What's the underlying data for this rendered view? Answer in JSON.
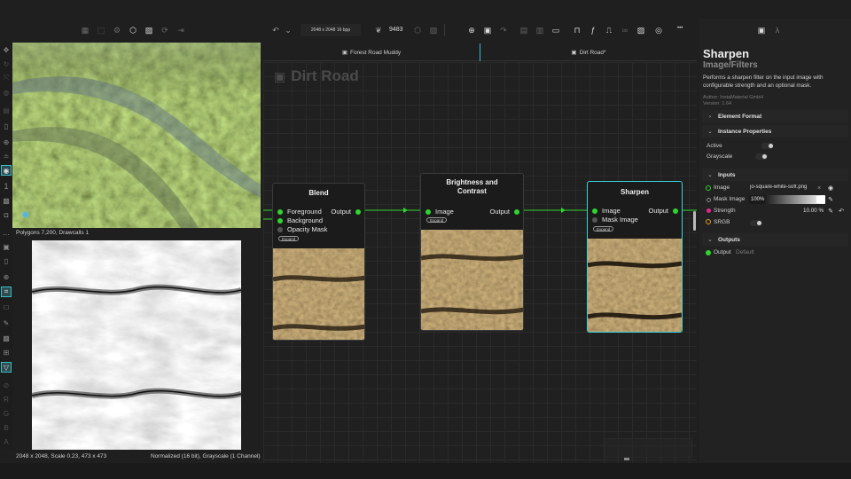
{
  "viewport_toolbar": {
    "icons": [
      "film-icon",
      "cube-open-icon",
      "gear-icon",
      "cube-icon",
      "image-icon",
      "refresh-icon",
      "export-icon"
    ]
  },
  "left_toolbar": {
    "group1": [
      "move-icon",
      "rotate-icon",
      "scale-icon",
      "sphere-icon",
      "layers-icon",
      "clipboard-icon",
      "target-icon",
      "lines-icon",
      "eye-icon"
    ],
    "channel_number": "1",
    "group2": [
      "checker-icon",
      "camera-icon",
      "more-icon",
      "save-icon",
      "clipboard-icon",
      "target-icon",
      "select-icon",
      "square-icon",
      "pen-icon",
      "checker-icon",
      "grid-icon",
      "triangle-icon",
      "lock-icon"
    ],
    "channels": [
      "R",
      "G",
      "B",
      "A"
    ]
  },
  "viewport_3d": {
    "status": "Polygons 7,200, Drawcalls 1"
  },
  "viewport_2d": {
    "status_left": "2048 x 2048, Scale 0.23, 473 x 473",
    "status_right": "Normalized (16 bit), Grayscale (1 Channel)"
  },
  "top_toolbar": {
    "undo_icon": "undo-icon",
    "resolution_select": "2048 x 2048 16 bpp",
    "seed_value": "9483",
    "more_label": "•••"
  },
  "tabs": [
    {
      "label": "Forest Road Muddy"
    },
    {
      "label": "Dirt Road*"
    }
  ],
  "graph": {
    "title": "Dirt Road",
    "nodes": {
      "blend": {
        "title": "Blend",
        "inputs": [
          "Foreground",
          "Background",
          "Opacity Mask"
        ],
        "output": "Output",
        "expand": "Expand"
      },
      "brightness": {
        "title": "Brightness and Contrast",
        "inputs": [
          "Image"
        ],
        "output": "Output",
        "expand": "Expand"
      },
      "sharpen": {
        "title": "Sharpen",
        "inputs": [
          "Image",
          "Mask Image"
        ],
        "output": "Output",
        "expand": "Expand"
      }
    }
  },
  "right_panel": {
    "title": "Sharpen",
    "subtitle": "Image/Filters",
    "description": "Performs a sharpen filter on the input image with configurable strength and an optional mask.",
    "author": "Author: InstaMaterial GmbH",
    "version": "Version: 1.64",
    "sections": {
      "element_format": "Element Format",
      "instance_properties": "Instance Properties",
      "inputs": "Inputs",
      "outputs": "Outputs"
    },
    "instance": {
      "active_label": "Active",
      "grayscale_label": "Grayscale"
    },
    "inputs": {
      "image_label": "Image",
      "image_value": "jo-square-white-soft.png",
      "mask_label": "Mask Image",
      "mask_value": "100%",
      "strength_label": "Strength",
      "strength_value": "10.00 %",
      "srgb_label": "SRGB"
    },
    "outputs": {
      "output_label": "Output",
      "output_value": "Default"
    }
  },
  "colors": {
    "accent": "#3fd2d8",
    "connection": "#2fd52f",
    "strength_dot": "#e0288c",
    "srgb_dot": "#e0a020"
  }
}
